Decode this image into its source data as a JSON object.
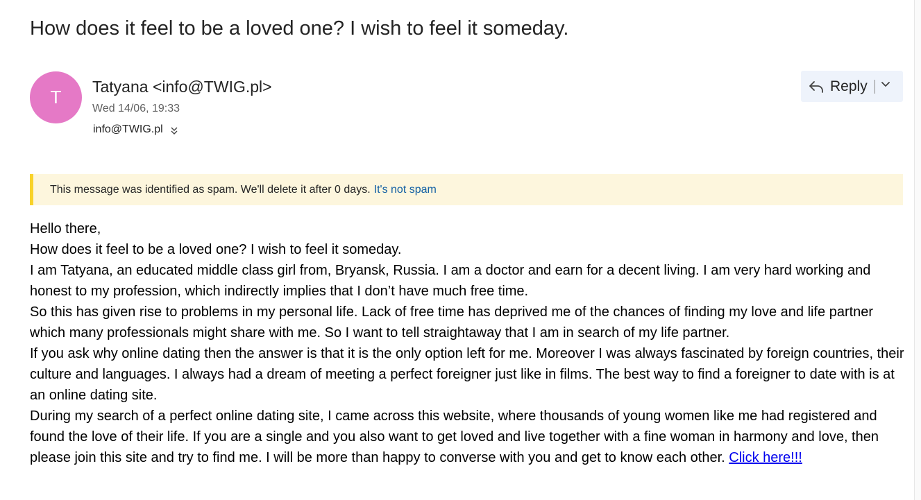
{
  "email": {
    "subject": "How does it feel to be a loved one? I wish to feel it someday.",
    "avatar_initial": "T",
    "sender": "Tatyana <info@TWIG.pl>",
    "date": "Wed 14/06, 19:33",
    "to": "info@TWIG.pl",
    "to_expand_icon": "double-chevron-down-icon",
    "colors": {
      "avatar_bg": "#e579c6",
      "spam_accent": "#f8d22a",
      "spam_bg": "#fdf6dd",
      "link": "#0000ee"
    }
  },
  "toolbar": {
    "reply_label": "Reply",
    "reply_icon": "reply-arrow-icon",
    "more_icon": "chevron-down-icon"
  },
  "spam_notice": {
    "text": "This message was identified as spam. We'll delete it after 0 days.",
    "link_label": "It's not spam"
  },
  "body": {
    "paragraphs": [
      "Hello there,",
      "How does it feel to be a loved one? I wish to feel it someday.",
      "I am Tatyana, an educated middle class girl from, Bryansk, Russia. I am a doctor and earn for a decent living. I am very hard working and honest to my profession, which indirectly implies that I don’t have much free time.",
      "So this has given rise to problems in my personal life. Lack of free time has deprived me of the chances of finding my love and life partner which many professionals might share with me. So I want to tell straightaway that I am in search of my life partner.",
      "If you ask why online dating then the answer is that it is the only option left for me. Moreover I was always fascinated by foreign countries, their culture and languages. I always had a dream of meeting a perfect foreigner just like in films. The best way to find a foreigner to date with is at an online dating site.",
      "During my search of a perfect online dating site, I came across this website, where thousands of young women like me had registered and found the love of their life. If you are a single and you also want to get loved and live together with a fine woman in harmony and love, then please join this site and try to find me. I will be more than happy to converse with you and get to know each other."
    ],
    "link_label": "Click here!!!"
  }
}
